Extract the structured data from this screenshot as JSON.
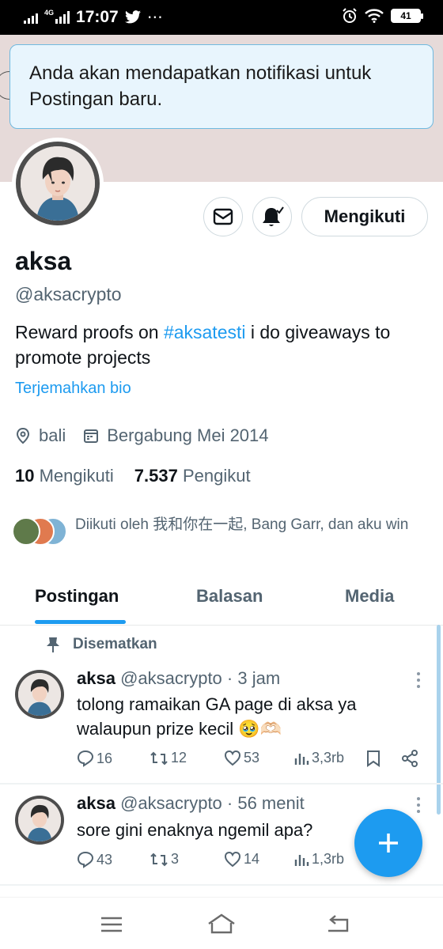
{
  "status_bar": {
    "network": "4G",
    "time": "17:07",
    "overflow": "⋯",
    "battery": "41",
    "icons": [
      "signal-icon",
      "twitter-bird-icon",
      "alarm-icon",
      "wifi-icon",
      "battery-icon"
    ]
  },
  "toast": {
    "message": "Anda akan mendapatkan notifikasi untuk Postingan baru."
  },
  "profile": {
    "name": "aksa",
    "handle": "@aksacrypto",
    "bio_before": "Reward proofs on ",
    "bio_hashtag": "#aksatesti",
    "bio_after": " i do giveaways to promote projects",
    "translate_label": "Terjemahkan bio",
    "location": "bali",
    "joined": "Bergabung Mei 2014",
    "following_count": "10",
    "following_label": "Mengikuti",
    "followers_count": "7.537",
    "followers_label": "Pengikut",
    "followed_by": "Diikuti oleh 我和你在一起, Bang Garr, dan aku win"
  },
  "actions": {
    "follow_label": "Mengikuti"
  },
  "tabs": [
    {
      "label": "Postingan",
      "active": true
    },
    {
      "label": "Balasan",
      "active": false
    },
    {
      "label": "Media",
      "active": false
    }
  ],
  "posts": [
    {
      "pinned_label": "Disematkan",
      "name": "aksa",
      "meta": "@aksacrypto · 3 jam",
      "text": "tolong ramaikan GA page di aksa ya walaupun prize kecil 🥹🫶🏻",
      "replies": "16",
      "reposts": "12",
      "likes": "53",
      "views": "3,3rb"
    },
    {
      "name": "aksa",
      "meta": "@aksacrypto · 56 menit",
      "text": "sore gini enaknya ngemil apa?",
      "replies": "43",
      "reposts": "3",
      "likes": "14",
      "views": "1,3rb"
    }
  ],
  "colors": {
    "accent": "#1d9bf0",
    "banner": "#e6dad9",
    "secondary_text": "#536471"
  }
}
